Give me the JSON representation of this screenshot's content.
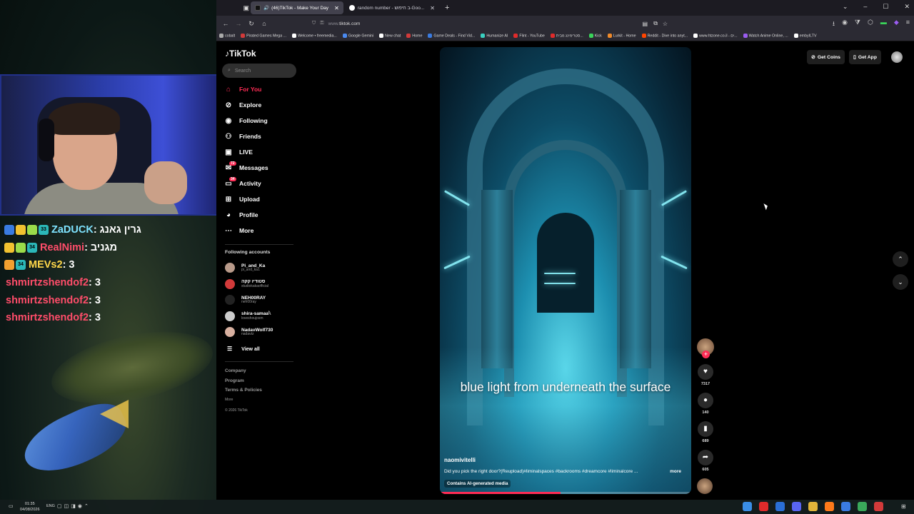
{
  "stream": {
    "chat": [
      {
        "user": "ZaDUCK",
        "color": "#7fe3ff",
        "msg": ": גרין גאנג",
        "badges": [
          "#3a7be0",
          "#f2c230",
          "#9bdc4a",
          "#2bb8b8"
        ],
        "badge_num": "33"
      },
      {
        "user": "RealNimi",
        "color": "#ff4d6a",
        "msg": ": מגניב",
        "badges": [
          "#f2c230",
          "#9bdc4a",
          "#2bb8b8"
        ],
        "badge_num": "34"
      },
      {
        "user": "MEVs2",
        "color": "#ffd84a",
        "msg": ": 3",
        "badges": [
          "#f2a030",
          "#2bb8b8"
        ],
        "badge_num": "34"
      },
      {
        "user": "shmirtzshendof2",
        "color": "#ff4d6a",
        "msg": ": 3",
        "badges": []
      },
      {
        "user": "shmirtzshendof2",
        "color": "#ff4d6a",
        "msg": ": 3",
        "badges": []
      },
      {
        "user": "shmirtzshendof2",
        "color": "#ff4d6a",
        "msg": ": 3",
        "badges": []
      }
    ]
  },
  "browser": {
    "tabs": [
      {
        "label": "(46)TikTok - Make Your Day",
        "active": true
      },
      {
        "label": "random number - ב חיפוש-Goo...",
        "active": false
      }
    ],
    "url_prefix": "www.",
    "url_domain": "tiktok.com",
    "bookmarks": [
      "cobalt",
      "Pirated Games Mega ...",
      "Welcome • freemedia...",
      "Google Gemini",
      "New chat",
      "Home",
      "Game Deals - Find Vid...",
      "Humanize AI",
      "Flint - YouTube",
      "סטרימינג מבית...",
      "Kick",
      "Lurkit - Home",
      "Reddit - Dive into anyt...",
      "www.htzone.co.il - ים...",
      "Watch Anime Online, ...",
      "embyILTV"
    ]
  },
  "tiktok": {
    "logo": "TikTok",
    "search_placeholder": "Search",
    "nav": [
      {
        "label": "For You",
        "icon": "home-icon",
        "active": true
      },
      {
        "label": "Explore",
        "icon": "compass-icon"
      },
      {
        "label": "Following",
        "icon": "following-icon"
      },
      {
        "label": "Friends",
        "icon": "friends-icon"
      },
      {
        "label": "LIVE",
        "icon": "live-icon"
      },
      {
        "label": "Messages",
        "icon": "messages-icon",
        "count": "72"
      },
      {
        "label": "Activity",
        "icon": "activity-icon",
        "count": "34"
      },
      {
        "label": "Upload",
        "icon": "upload-icon"
      },
      {
        "label": "Profile",
        "icon": "profile-icon"
      },
      {
        "label": "More",
        "icon": "more-icon"
      }
    ],
    "following_title": "Following accounts",
    "accounts": [
      {
        "name": "Pi_and_Ka",
        "handle": "pi_and_ka1",
        "color": "#b89a8a"
      },
      {
        "name": "סטודיו קקה",
        "handle": "studiokakaofficial",
        "color": "#d23a3a"
      },
      {
        "name": "NEH00RAY",
        "handle": "neh00ray",
        "color": "#222"
      },
      {
        "name": "shira-samaa𓆩",
        "handle": "loveshoujosm",
        "color": "#ccc"
      },
      {
        "name": "NadavWolf730",
        "handle": "nadavtz",
        "color": "#d8b0a0"
      }
    ],
    "view_all": "View all",
    "footer": [
      "Company",
      "Program",
      "Terms & Policies"
    ],
    "footer_more": "More",
    "copyright": "© 2026 TikTok",
    "get_coins": "Get Coins",
    "get_app": "Get App",
    "video": {
      "caption": "blue light from underneath the surface",
      "author": "naomivitelli",
      "description": "Did you pick the right door?(Reupload)#liminalspaces #backrooms #dreamcore #liminalcore ...",
      "more": "more",
      "ai_label": "Contains AI-generated media",
      "progress": 0.48
    },
    "actions": {
      "likes": "7317",
      "comments": "140",
      "saves": "689",
      "shares": "605"
    }
  },
  "taskbar": {
    "time": "01:35",
    "date": "04/08/2026",
    "lang": "ENG",
    "apps": [
      "#3a8ee6",
      "#e02b2b",
      "#2a6fd6",
      "#5865f2",
      "#e0b43a",
      "#ff7a1a",
      "#3a7be0",
      "#3aa85a",
      "#d23a3a"
    ]
  }
}
